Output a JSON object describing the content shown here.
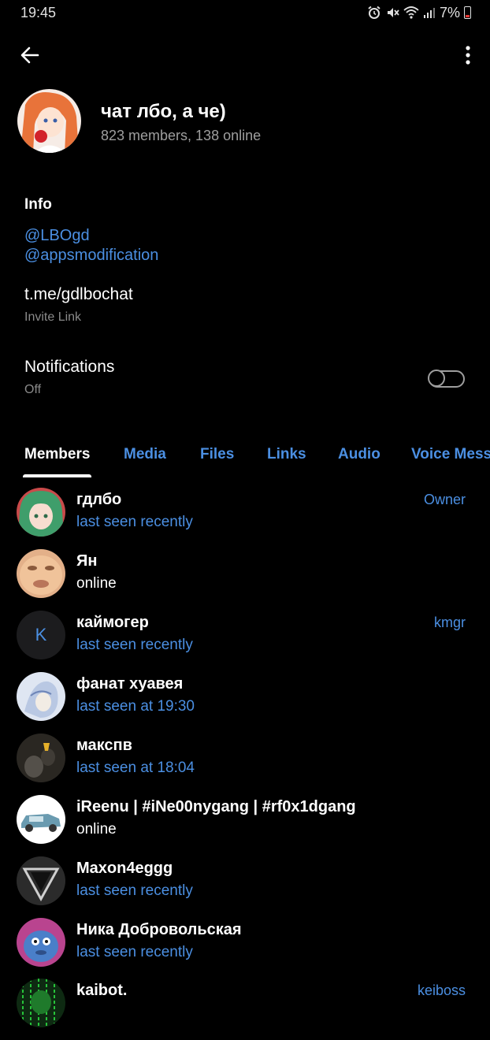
{
  "status_bar": {
    "time": "19:45",
    "battery": "7%"
  },
  "group": {
    "title": "чат лбо, а че)",
    "subtitle": "823 members, 138 online"
  },
  "info": {
    "header": "Info",
    "links": [
      "@LBOgd",
      "@appsmodification"
    ],
    "invite_link": "t.me/gdlbochat",
    "invite_caption": "Invite Link"
  },
  "notifications": {
    "label": "Notifications",
    "state": "Off",
    "enabled": false
  },
  "tabs": [
    {
      "label": "Members",
      "active": true
    },
    {
      "label": "Media",
      "active": false
    },
    {
      "label": "Files",
      "active": false
    },
    {
      "label": "Links",
      "active": false
    },
    {
      "label": "Audio",
      "active": false
    },
    {
      "label": "Voice Mess",
      "active": false
    }
  ],
  "members": [
    {
      "name": "гдлбо",
      "status": "last seen recently",
      "role": "Owner",
      "avatar": "anime-girl-green-hair"
    },
    {
      "name": "Ян",
      "status": "online",
      "role": "",
      "avatar": "face-photo"
    },
    {
      "name": "каймогер",
      "status": "last seen recently",
      "role": "kmgr",
      "avatar_letter": "K"
    },
    {
      "name": "фанат хуавея",
      "status": "last seen at 19:30",
      "role": "",
      "avatar": "anime-sketch"
    },
    {
      "name": "макспв",
      "status": "last seen at 18:04",
      "role": "",
      "avatar": "dark-photo"
    },
    {
      "name": "iReenu | #iNe00nygang | #rf0x1dgang",
      "status": "online",
      "role": "",
      "avatar": "blue-car"
    },
    {
      "name": "Maxon4eggg",
      "status": "last seen recently",
      "role": "",
      "avatar": "triangle-logo"
    },
    {
      "name": "Ника Добровольская",
      "status": "last seen recently",
      "role": "",
      "avatar": "purple-creature"
    },
    {
      "name": "kaibot.",
      "status": "",
      "role": "keiboss",
      "avatar": "green-matrix"
    }
  ],
  "colors": {
    "background": "#000000",
    "accent": "#4b8fe2",
    "secondary_text": "#9e9e9e"
  }
}
